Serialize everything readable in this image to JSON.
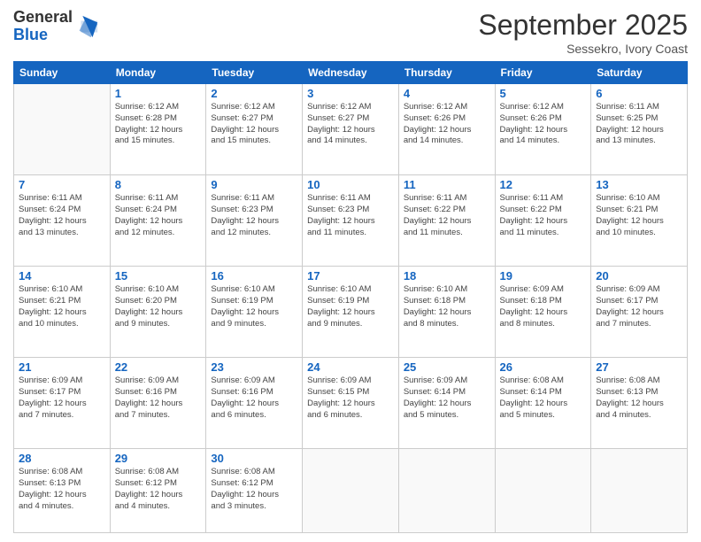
{
  "logo": {
    "general": "General",
    "blue": "Blue"
  },
  "header": {
    "month": "September 2025",
    "location": "Sessekro, Ivory Coast"
  },
  "days_of_week": [
    "Sunday",
    "Monday",
    "Tuesday",
    "Wednesday",
    "Thursday",
    "Friday",
    "Saturday"
  ],
  "weeks": [
    [
      {
        "day": "",
        "info": ""
      },
      {
        "day": "1",
        "info": "Sunrise: 6:12 AM\nSunset: 6:28 PM\nDaylight: 12 hours\nand 15 minutes."
      },
      {
        "day": "2",
        "info": "Sunrise: 6:12 AM\nSunset: 6:27 PM\nDaylight: 12 hours\nand 15 minutes."
      },
      {
        "day": "3",
        "info": "Sunrise: 6:12 AM\nSunset: 6:27 PM\nDaylight: 12 hours\nand 14 minutes."
      },
      {
        "day": "4",
        "info": "Sunrise: 6:12 AM\nSunset: 6:26 PM\nDaylight: 12 hours\nand 14 minutes."
      },
      {
        "day": "5",
        "info": "Sunrise: 6:12 AM\nSunset: 6:26 PM\nDaylight: 12 hours\nand 14 minutes."
      },
      {
        "day": "6",
        "info": "Sunrise: 6:11 AM\nSunset: 6:25 PM\nDaylight: 12 hours\nand 13 minutes."
      }
    ],
    [
      {
        "day": "7",
        "info": "Sunrise: 6:11 AM\nSunset: 6:24 PM\nDaylight: 12 hours\nand 13 minutes."
      },
      {
        "day": "8",
        "info": "Sunrise: 6:11 AM\nSunset: 6:24 PM\nDaylight: 12 hours\nand 12 minutes."
      },
      {
        "day": "9",
        "info": "Sunrise: 6:11 AM\nSunset: 6:23 PM\nDaylight: 12 hours\nand 12 minutes."
      },
      {
        "day": "10",
        "info": "Sunrise: 6:11 AM\nSunset: 6:23 PM\nDaylight: 12 hours\nand 11 minutes."
      },
      {
        "day": "11",
        "info": "Sunrise: 6:11 AM\nSunset: 6:22 PM\nDaylight: 12 hours\nand 11 minutes."
      },
      {
        "day": "12",
        "info": "Sunrise: 6:11 AM\nSunset: 6:22 PM\nDaylight: 12 hours\nand 11 minutes."
      },
      {
        "day": "13",
        "info": "Sunrise: 6:10 AM\nSunset: 6:21 PM\nDaylight: 12 hours\nand 10 minutes."
      }
    ],
    [
      {
        "day": "14",
        "info": "Sunrise: 6:10 AM\nSunset: 6:21 PM\nDaylight: 12 hours\nand 10 minutes."
      },
      {
        "day": "15",
        "info": "Sunrise: 6:10 AM\nSunset: 6:20 PM\nDaylight: 12 hours\nand 9 minutes."
      },
      {
        "day": "16",
        "info": "Sunrise: 6:10 AM\nSunset: 6:19 PM\nDaylight: 12 hours\nand 9 minutes."
      },
      {
        "day": "17",
        "info": "Sunrise: 6:10 AM\nSunset: 6:19 PM\nDaylight: 12 hours\nand 9 minutes."
      },
      {
        "day": "18",
        "info": "Sunrise: 6:10 AM\nSunset: 6:18 PM\nDaylight: 12 hours\nand 8 minutes."
      },
      {
        "day": "19",
        "info": "Sunrise: 6:09 AM\nSunset: 6:18 PM\nDaylight: 12 hours\nand 8 minutes."
      },
      {
        "day": "20",
        "info": "Sunrise: 6:09 AM\nSunset: 6:17 PM\nDaylight: 12 hours\nand 7 minutes."
      }
    ],
    [
      {
        "day": "21",
        "info": "Sunrise: 6:09 AM\nSunset: 6:17 PM\nDaylight: 12 hours\nand 7 minutes."
      },
      {
        "day": "22",
        "info": "Sunrise: 6:09 AM\nSunset: 6:16 PM\nDaylight: 12 hours\nand 7 minutes."
      },
      {
        "day": "23",
        "info": "Sunrise: 6:09 AM\nSunset: 6:16 PM\nDaylight: 12 hours\nand 6 minutes."
      },
      {
        "day": "24",
        "info": "Sunrise: 6:09 AM\nSunset: 6:15 PM\nDaylight: 12 hours\nand 6 minutes."
      },
      {
        "day": "25",
        "info": "Sunrise: 6:09 AM\nSunset: 6:14 PM\nDaylight: 12 hours\nand 5 minutes."
      },
      {
        "day": "26",
        "info": "Sunrise: 6:08 AM\nSunset: 6:14 PM\nDaylight: 12 hours\nand 5 minutes."
      },
      {
        "day": "27",
        "info": "Sunrise: 6:08 AM\nSunset: 6:13 PM\nDaylight: 12 hours\nand 4 minutes."
      }
    ],
    [
      {
        "day": "28",
        "info": "Sunrise: 6:08 AM\nSunset: 6:13 PM\nDaylight: 12 hours\nand 4 minutes."
      },
      {
        "day": "29",
        "info": "Sunrise: 6:08 AM\nSunset: 6:12 PM\nDaylight: 12 hours\nand 4 minutes."
      },
      {
        "day": "30",
        "info": "Sunrise: 6:08 AM\nSunset: 6:12 PM\nDaylight: 12 hours\nand 3 minutes."
      },
      {
        "day": "",
        "info": ""
      },
      {
        "day": "",
        "info": ""
      },
      {
        "day": "",
        "info": ""
      },
      {
        "day": "",
        "info": ""
      }
    ]
  ]
}
